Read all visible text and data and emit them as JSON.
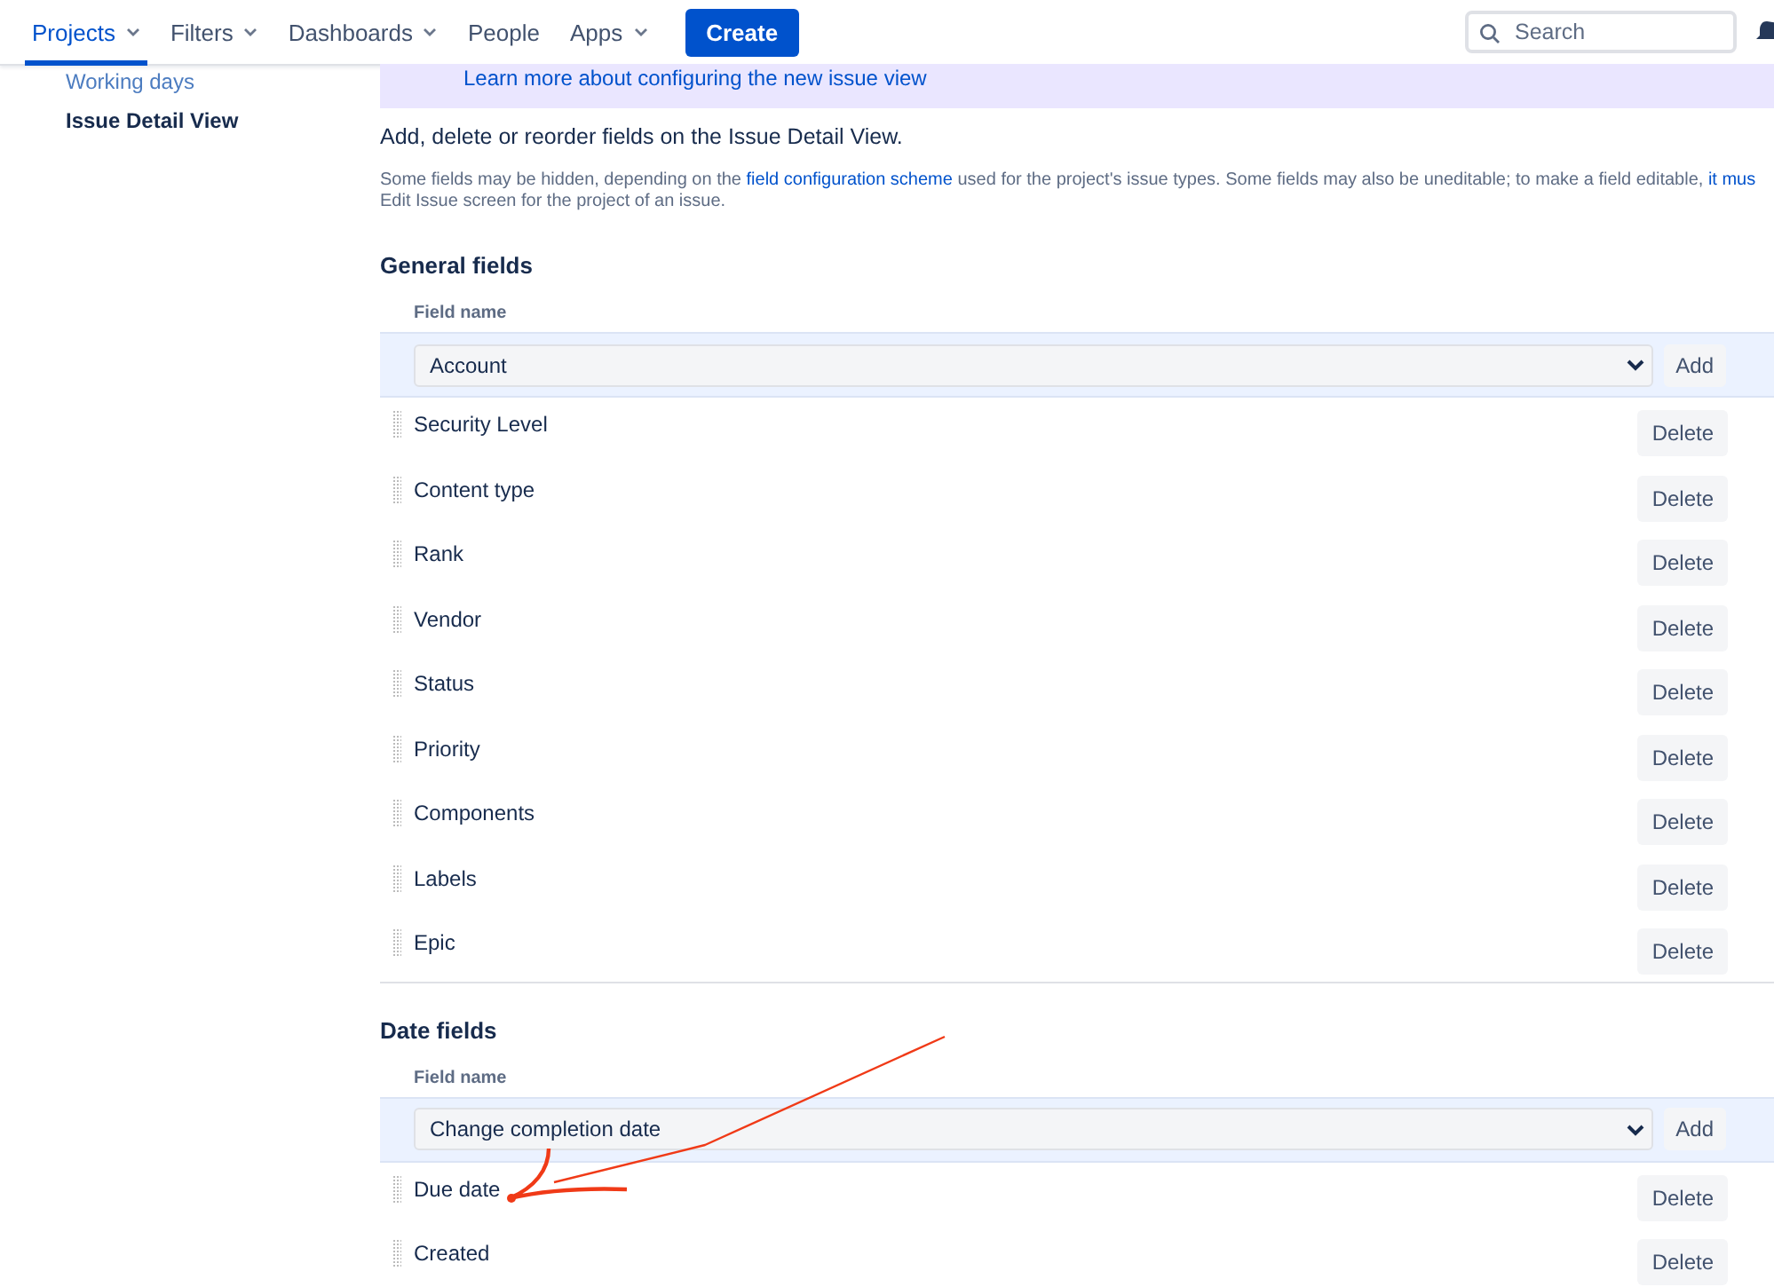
{
  "nav": {
    "items": [
      {
        "label": "Projects",
        "dropdown": true,
        "selected": true
      },
      {
        "label": "Filters",
        "dropdown": true,
        "selected": false
      },
      {
        "label": "Dashboards",
        "dropdown": true,
        "selected": false
      },
      {
        "label": "People",
        "dropdown": false,
        "selected": false
      },
      {
        "label": "Apps",
        "dropdown": true,
        "selected": false
      }
    ],
    "create_button": "Create",
    "search": {
      "placeholder": "Search"
    }
  },
  "sidebar": {
    "items": [
      {
        "label": "Working days",
        "selected": false
      },
      {
        "label": "Issue Detail View",
        "selected": true
      }
    ]
  },
  "banner": {
    "link": "Learn more about configuring the new issue view"
  },
  "intro": "Add, delete or reorder fields on the Issue Detail View.",
  "note": {
    "lines": [
      [
        {
          "text": "Some fields may be hidden, depending on the ",
          "link": false
        },
        {
          "text": "field configuration scheme",
          "link": true
        },
        {
          "text": " used for the project's issue types. Some fields may also be uneditable; to make a field editable, ",
          "link": false
        },
        {
          "text": "it mus",
          "link": true
        }
      ],
      [
        {
          "text": "Edit Issue screen for the project of an issue.",
          "link": false
        }
      ]
    ]
  },
  "sections": [
    {
      "title": "General fields",
      "column": "Field name",
      "select_value": "Account",
      "add_button": "Add",
      "fields": [
        {
          "name": "Security Level",
          "delete_button": "Delete"
        },
        {
          "name": "Content type",
          "delete_button": "Delete"
        },
        {
          "name": "Rank",
          "delete_button": "Delete"
        },
        {
          "name": "Vendor",
          "delete_button": "Delete"
        },
        {
          "name": "Status",
          "delete_button": "Delete"
        },
        {
          "name": "Priority",
          "delete_button": "Delete"
        },
        {
          "name": "Components",
          "delete_button": "Delete"
        },
        {
          "name": "Labels",
          "delete_button": "Delete"
        },
        {
          "name": "Epic",
          "delete_button": "Delete"
        }
      ]
    },
    {
      "title": "Date fields",
      "column": "Field name",
      "select_value": "Change completion date",
      "add_button": "Add",
      "fields": [
        {
          "name": "Due date",
          "delete_button": "Delete"
        },
        {
          "name": "Created",
          "delete_button": "Delete"
        }
      ]
    }
  ]
}
